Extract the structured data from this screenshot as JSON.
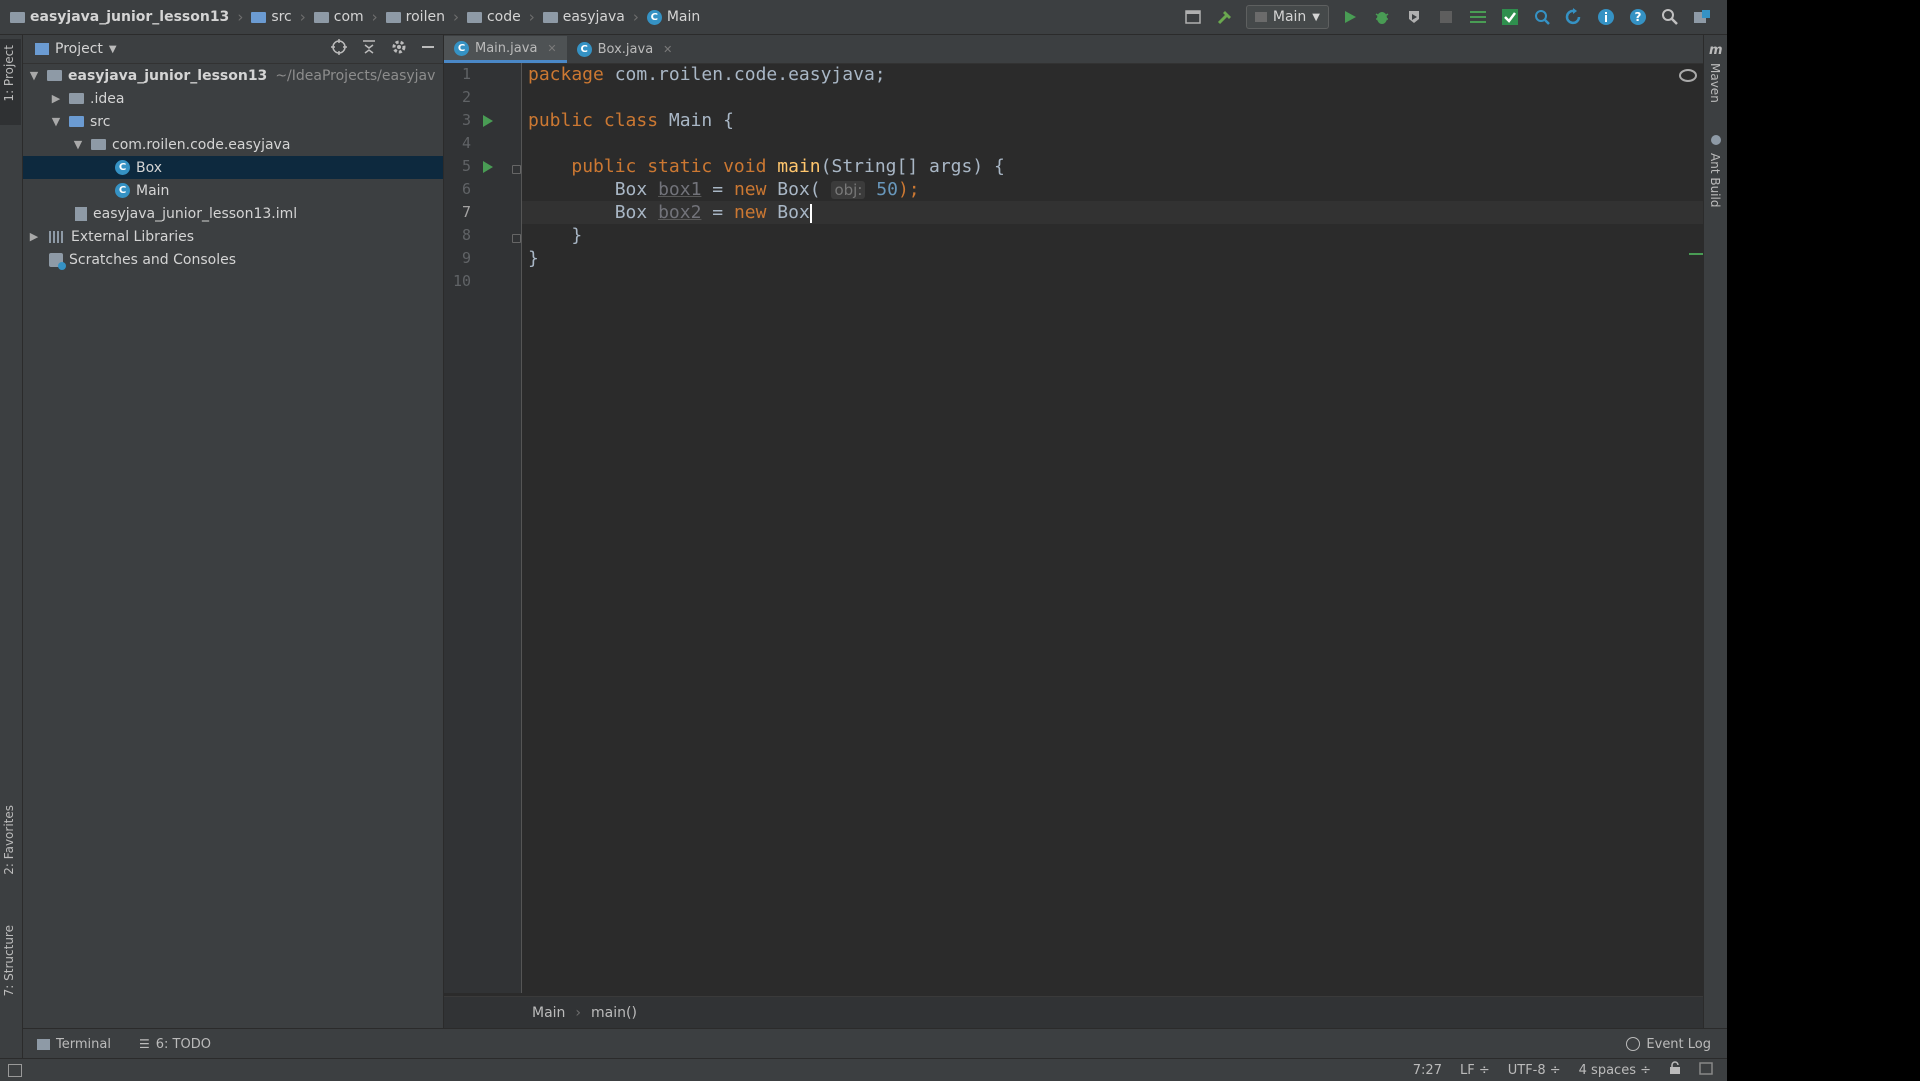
{
  "navbar": {
    "crumbs": [
      "easyjava_junior_lesson13",
      "src",
      "com",
      "roilen",
      "code",
      "easyjava",
      "Main"
    ],
    "run_config": "Main"
  },
  "left_stripe": {
    "project_tab": "1: Project",
    "favorites_tab": "2: Favorites",
    "structure_tab": "7: Structure"
  },
  "right_stripe": {
    "maven_tab": "Maven",
    "ant_tab": "Ant Build"
  },
  "project": {
    "header": "Project",
    "tree": [
      {
        "label": "easyjava_junior_lesson13",
        "path": "~/IdeaProjects/easyjav"
      },
      {
        "label": ".idea"
      },
      {
        "label": "src"
      },
      {
        "label": "com.roilen.code.easyjava"
      },
      {
        "label": "Box"
      },
      {
        "label": "Main"
      },
      {
        "label": "easyjava_junior_lesson13.iml"
      },
      {
        "label": "External Libraries"
      },
      {
        "label": "Scratches and Consoles"
      }
    ]
  },
  "editor": {
    "tabs": [
      "Main.java",
      "Box.java"
    ],
    "line_numbers": [
      "1",
      "2",
      "3",
      "4",
      "5",
      "6",
      "7",
      "8",
      "9",
      "10"
    ],
    "current_line": "7",
    "code": {
      "l1_kw": "package",
      "l1_rest": " com.roilen.code.easyjava;",
      "l3_kw": "public class",
      "l3_rest": " Main {",
      "l5_kw": "public static void",
      "l5_fn": "main",
      "l5_rest": "(String[] args) {",
      "l6_type": "Box ",
      "l6_var": "box1",
      "l6_eq": " = ",
      "l6_new": "new",
      "l6_call": " Box(",
      "l6_hint": "obj:",
      "l6_num": "50",
      "l6_end": ");",
      "l7_type": "Box ",
      "l7_var": "box2",
      "l7_eq": " = ",
      "l7_new": "new",
      "l7_call": " Box",
      "l8": "}",
      "l9": "}"
    },
    "breadcrumb": [
      "Main",
      "main()"
    ]
  },
  "bottom_tools": {
    "terminal": "Terminal",
    "todo": "6: TODO",
    "event_log": "Event Log"
  },
  "status": {
    "position": "7:27",
    "line_sep": "LF ÷",
    "encoding": "UTF-8 ÷",
    "indent": "4 spaces ÷"
  }
}
